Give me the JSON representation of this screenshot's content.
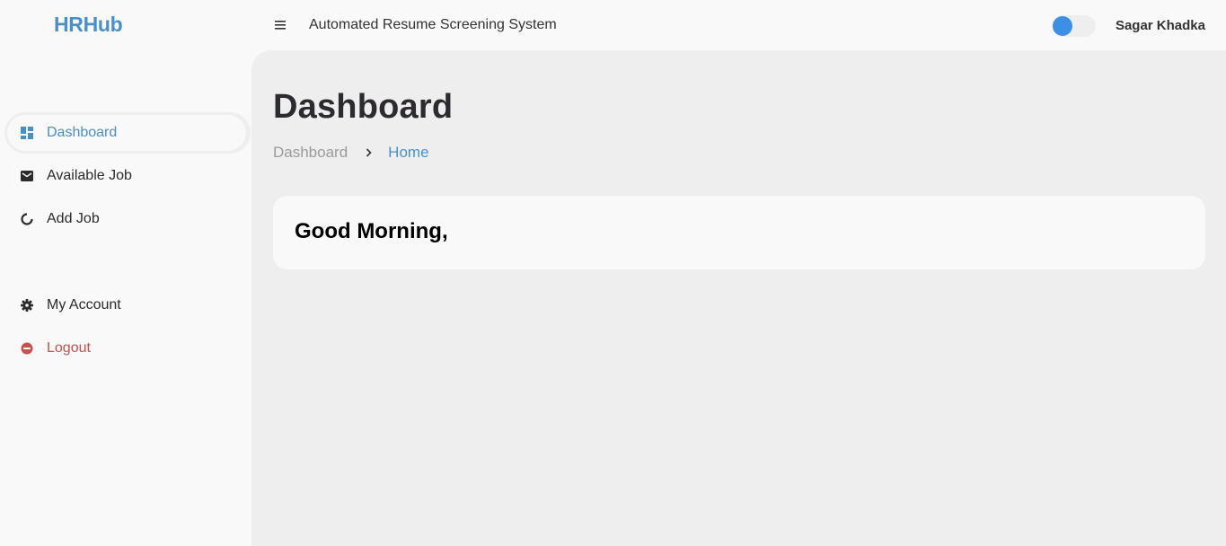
{
  "header": {
    "brand": "HRHub",
    "app_title": "Automated Resume Screening System",
    "user_name": "Sagar Khadka",
    "theme_toggle_on": false
  },
  "sidebar": {
    "items": [
      {
        "label": "Dashboard",
        "icon": "dashboard-icon",
        "active": true
      },
      {
        "label": "Available Job",
        "icon": "mail-icon"
      },
      {
        "label": "Add Job",
        "icon": "refresh-icon"
      },
      {
        "label": "My Account",
        "icon": "gear-icon"
      },
      {
        "label": "Logout",
        "icon": "logout-icon"
      }
    ]
  },
  "main": {
    "title": "Dashboard",
    "breadcrumb": [
      "Dashboard",
      "Home"
    ],
    "greeting": "Good Morning,"
  },
  "colors": {
    "accent": "#4a90c8",
    "toggle_knob": "#3d8fe6",
    "logout": "#c9504c",
    "main_bg": "#eeeeee"
  }
}
